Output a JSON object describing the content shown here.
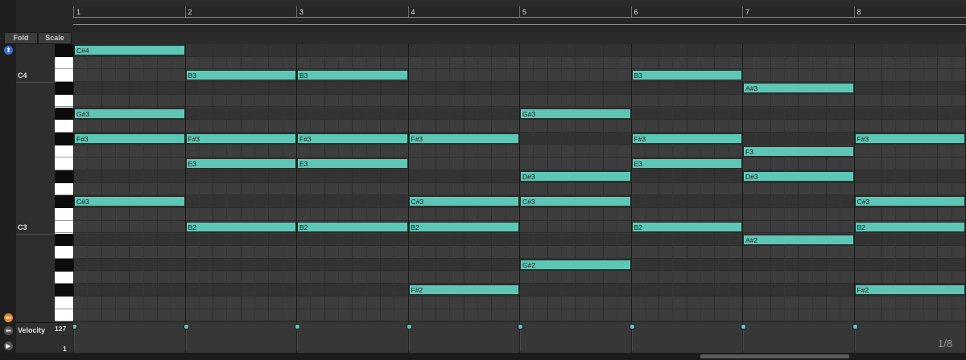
{
  "header": {
    "fold_label": "Fold",
    "scale_label": "Scale",
    "bars": [
      "1",
      "2",
      "3",
      "4",
      "5",
      "6",
      "7",
      "8"
    ]
  },
  "keyboard": {
    "octave_labels": [
      {
        "text": "C4",
        "row": 2
      },
      {
        "text": "C3",
        "row": 14
      }
    ]
  },
  "notes": [
    {
      "label": "C#4",
      "row": 0,
      "start": 0,
      "length": 1
    },
    {
      "label": "B3",
      "row": 2,
      "start": 1,
      "length": 1
    },
    {
      "label": "B3",
      "row": 2,
      "start": 2,
      "length": 1
    },
    {
      "label": "B3",
      "row": 2,
      "start": 5,
      "length": 1
    },
    {
      "label": "A#3",
      "row": 3,
      "start": 6,
      "length": 1
    },
    {
      "label": "G#3",
      "row": 5,
      "start": 0,
      "length": 1
    },
    {
      "label": "G#3",
      "row": 5,
      "start": 4,
      "length": 1
    },
    {
      "label": "F#3",
      "row": 7,
      "start": 0,
      "length": 1
    },
    {
      "label": "F#3",
      "row": 7,
      "start": 1,
      "length": 1
    },
    {
      "label": "F#3",
      "row": 7,
      "start": 2,
      "length": 1
    },
    {
      "label": "F#3",
      "row": 7,
      "start": 3,
      "length": 1
    },
    {
      "label": "F#3",
      "row": 7,
      "start": 5,
      "length": 1
    },
    {
      "label": "F#3",
      "row": 7,
      "start": 7,
      "length": 1
    },
    {
      "label": "F3",
      "row": 8,
      "start": 6,
      "length": 1
    },
    {
      "label": "E3",
      "row": 9,
      "start": 1,
      "length": 1
    },
    {
      "label": "E3",
      "row": 9,
      "start": 2,
      "length": 1
    },
    {
      "label": "E3",
      "row": 9,
      "start": 5,
      "length": 1
    },
    {
      "label": "D#3",
      "row": 10,
      "start": 4,
      "length": 1
    },
    {
      "label": "D#3",
      "row": 10,
      "start": 6,
      "length": 1
    },
    {
      "label": "C#3",
      "row": 12,
      "start": 0,
      "length": 1
    },
    {
      "label": "C#3",
      "row": 12,
      "start": 3,
      "length": 1
    },
    {
      "label": "C#3",
      "row": 12,
      "start": 4,
      "length": 1
    },
    {
      "label": "C#3",
      "row": 12,
      "start": 7,
      "length": 1
    },
    {
      "label": "B2",
      "row": 14,
      "start": 1,
      "length": 1
    },
    {
      "label": "B2",
      "row": 14,
      "start": 2,
      "length": 1
    },
    {
      "label": "B2",
      "row": 14,
      "start": 3,
      "length": 1
    },
    {
      "label": "B2",
      "row": 14,
      "start": 5,
      "length": 1
    },
    {
      "label": "B2",
      "row": 14,
      "start": 7,
      "length": 1
    },
    {
      "label": "A#2",
      "row": 15,
      "start": 6,
      "length": 1
    },
    {
      "label": "G#2",
      "row": 17,
      "start": 4,
      "length": 1
    },
    {
      "label": "F#2",
      "row": 19,
      "start": 3,
      "length": 1
    },
    {
      "label": "F#2",
      "row": 19,
      "start": 7,
      "length": 1
    }
  ],
  "velocity": {
    "title": "Velocity",
    "max_label": "127",
    "min_label": "1",
    "values": [
      127,
      127,
      127,
      127,
      127,
      127,
      127,
      127
    ]
  },
  "status": {
    "grid_quantization": "1/8"
  },
  "colors": {
    "note": "#5ec6b4",
    "background": "#3a3a3a"
  }
}
